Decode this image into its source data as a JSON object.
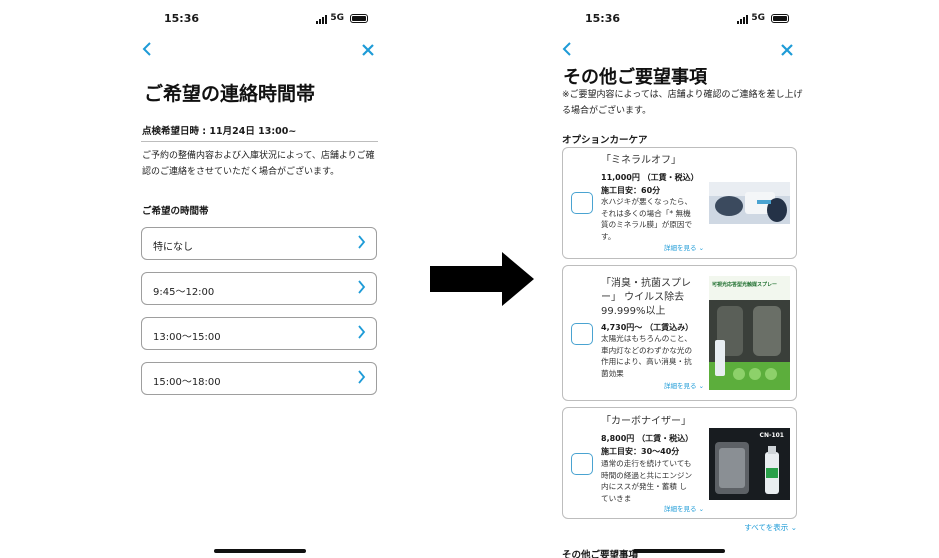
{
  "left": {
    "status": {
      "time": "15:36",
      "network": "5G"
    },
    "title": "ご希望の連絡時間帯",
    "date_line": "点検希望日時 : 11月24日 13:00~",
    "description": "ご予約の整備内容および入庫状況によって、店舗よりご確認のご連絡をさせていただく場合がございます。",
    "section_title": "ご希望の時間帯",
    "options": [
      "特になし",
      "9:45〜12:00",
      "13:00〜15:00",
      "15:00〜18:00"
    ]
  },
  "right": {
    "status": {
      "time": "15:36",
      "network": "5G"
    },
    "title": "その他ご要望事項",
    "note": "※ご要望内容によっては、店舗より確認のご連絡を差し上げる場合がございます。",
    "section_title": "オプションカーケア",
    "products": [
      {
        "name": "「ミネラルオフ」",
        "price": "11,000円 （工賃・税込）",
        "estimate": "施工目安：60分",
        "description": "水ハジキが悪くなったら、それは多くの場合「* 無機質のミネラル膜」が原因です。",
        "more": "詳細を見る"
      },
      {
        "name": "「消臭・抗菌スプレー」 ウイルス除去99.999%以上",
        "price": "4,730円〜 （工賃込み）",
        "estimate": "",
        "description": "太陽光はもちろんのこと、車内灯などのわずかな光の作用により、高い消臭・抗菌効果",
        "more": "詳細を見る",
        "image_caption": "可視光応答型光触媒スプレー"
      },
      {
        "name": "「カーボナイザー」",
        "price": "8,800円 （工賃・税込）",
        "estimate": "施工目安：30〜40分",
        "description": "通常の走行を続けていても時間の経過と共にエンジン内にススが発生・蓄積 していきま",
        "more": "詳細を見る",
        "image_caption": "CN-101"
      }
    ],
    "show_all": "すべてを表示",
    "bottom_heading": "その他ご要望事項"
  },
  "colors": {
    "accent": "#1e9bd7",
    "text": "#1a1a1a",
    "border": "#bdbdbd"
  },
  "icons": {
    "back": "chevron-left-icon",
    "close": "close-icon",
    "option_chevron": "chevron-right-icon",
    "transition": "right-arrow-icon"
  }
}
